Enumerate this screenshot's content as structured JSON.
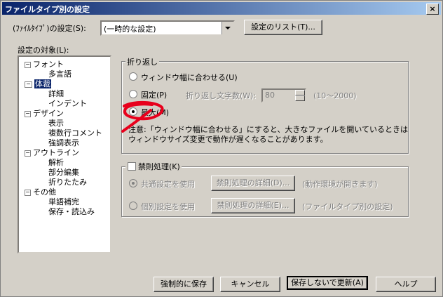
{
  "window": {
    "title": "ファイルタイプ別の設定",
    "close_glyph": "×"
  },
  "filetype": {
    "label": "(ﾌｧｲﾙﾀｲﾌﾟ)の設定(S):",
    "selected": "(一時的な設定)",
    "list_button": "設定のリスト(T)..."
  },
  "tree": {
    "label": "設定の対象(L):",
    "items": [
      {
        "label": "フォント",
        "expander": "−"
      },
      {
        "label": "多言語",
        "expander": ""
      },
      {
        "label": "体裁",
        "expander": "−"
      },
      {
        "label": "詳細",
        "expander": ""
      },
      {
        "label": "インデント",
        "expander": ""
      },
      {
        "label": "デザイン",
        "expander": "−"
      },
      {
        "label": "表示",
        "expander": ""
      },
      {
        "label": "複数行コメント",
        "expander": ""
      },
      {
        "label": "強調表示",
        "expander": ""
      },
      {
        "label": "アウトライン",
        "expander": "−"
      },
      {
        "label": "解析",
        "expander": ""
      },
      {
        "label": "部分編集",
        "expander": ""
      },
      {
        "label": "折りたたみ",
        "expander": ""
      },
      {
        "label": "その他",
        "expander": "−"
      },
      {
        "label": "単語補完",
        "expander": ""
      },
      {
        "label": "保存・読込み",
        "expander": ""
      }
    ]
  },
  "wrap": {
    "group_label": "折り返し",
    "option_window": "ウィンドウ幅に合わせる(U)",
    "option_fixed": "固定(P)",
    "chars_label": "折り返し文字数(W):",
    "chars_value": "80",
    "range": "(10～2000)",
    "option_max": "最大(M)",
    "note_line1": "注意:「ウィンドウ幅に合わせる」にすると、大きなファイルを開いているときは",
    "note_line2": "ウィンドウサイズ変更で動作が遅くなることがあります。"
  },
  "kinsoku": {
    "group_label": "禁則処理(K)",
    "common_label": "共通設定を使用",
    "common_detail_button": "禁則処理の詳細(D)...",
    "common_note": "(動作環境が開きます)",
    "individual_label": "個別設定を使用",
    "individual_detail_button": "禁則処理の詳細(E)...",
    "individual_note": "(ファイルタイプ別の設定)"
  },
  "footer": {
    "force_save": "強制的に保存",
    "cancel": "キャンセル",
    "update_no_save": "保存しないで更新(A)",
    "help": "ヘルプ"
  },
  "annotation": {
    "color": "#e8001c"
  }
}
